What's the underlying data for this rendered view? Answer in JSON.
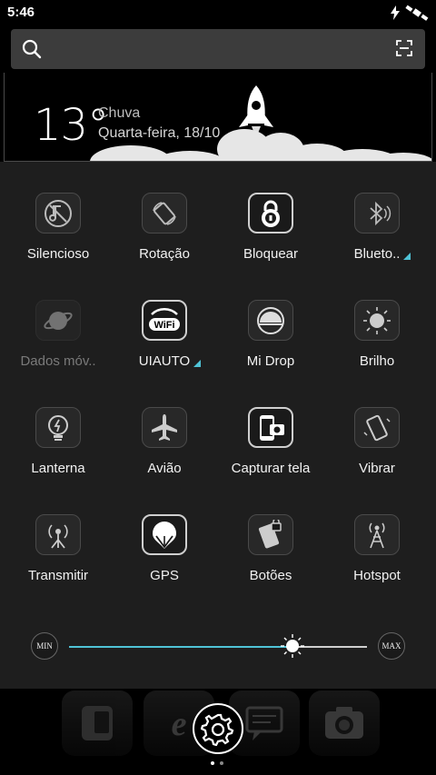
{
  "status": {
    "time": "5:46"
  },
  "weather": {
    "temperature": "13°",
    "condition": "Chuva",
    "date": "Quarta-feira, 18/10"
  },
  "tiles": [
    {
      "label": "Silencioso",
      "icon": "silent-icon",
      "state": "normal"
    },
    {
      "label": "Rotação",
      "icon": "rotation-icon",
      "state": "normal"
    },
    {
      "label": "Bloquear",
      "icon": "lock-icon",
      "state": "active"
    },
    {
      "label": "Blueto..",
      "icon": "bluetooth-icon",
      "state": "normal",
      "has_menu": true
    },
    {
      "label": "Dados móv..",
      "icon": "mobile-data-icon",
      "state": "dim"
    },
    {
      "label": "UIAUTO",
      "icon": "wifi-icon",
      "state": "active",
      "has_menu": true
    },
    {
      "label": "Mi Drop",
      "icon": "mi-drop-icon",
      "state": "normal"
    },
    {
      "label": "Brilho",
      "icon": "brightness-icon",
      "state": "normal"
    },
    {
      "label": "Lanterna",
      "icon": "flashlight-icon",
      "state": "normal"
    },
    {
      "label": "Avião",
      "icon": "airplane-icon",
      "state": "normal"
    },
    {
      "label": "Capturar tela",
      "icon": "screenshot-icon",
      "state": "active"
    },
    {
      "label": "Vibrar",
      "icon": "vibrate-icon",
      "state": "normal"
    },
    {
      "label": "Transmitir",
      "icon": "cast-icon",
      "state": "normal"
    },
    {
      "label": "GPS",
      "icon": "gps-icon",
      "state": "active"
    },
    {
      "label": "Botões",
      "icon": "buttons-icon",
      "state": "normal"
    },
    {
      "label": "Hotspot",
      "icon": "hotspot-icon",
      "state": "normal"
    }
  ],
  "brightness": {
    "min_label": "MIN",
    "max_label": "MAX",
    "level": 0.75
  },
  "colors": {
    "accent": "#4fc3d6",
    "panel": "#1e1e1e",
    "search": "#3c3c3c"
  },
  "dock": {
    "apps": [
      "phone-icon",
      "browser-icon",
      "messages-icon",
      "camera-icon"
    ],
    "page": 1,
    "page_count": 2
  }
}
